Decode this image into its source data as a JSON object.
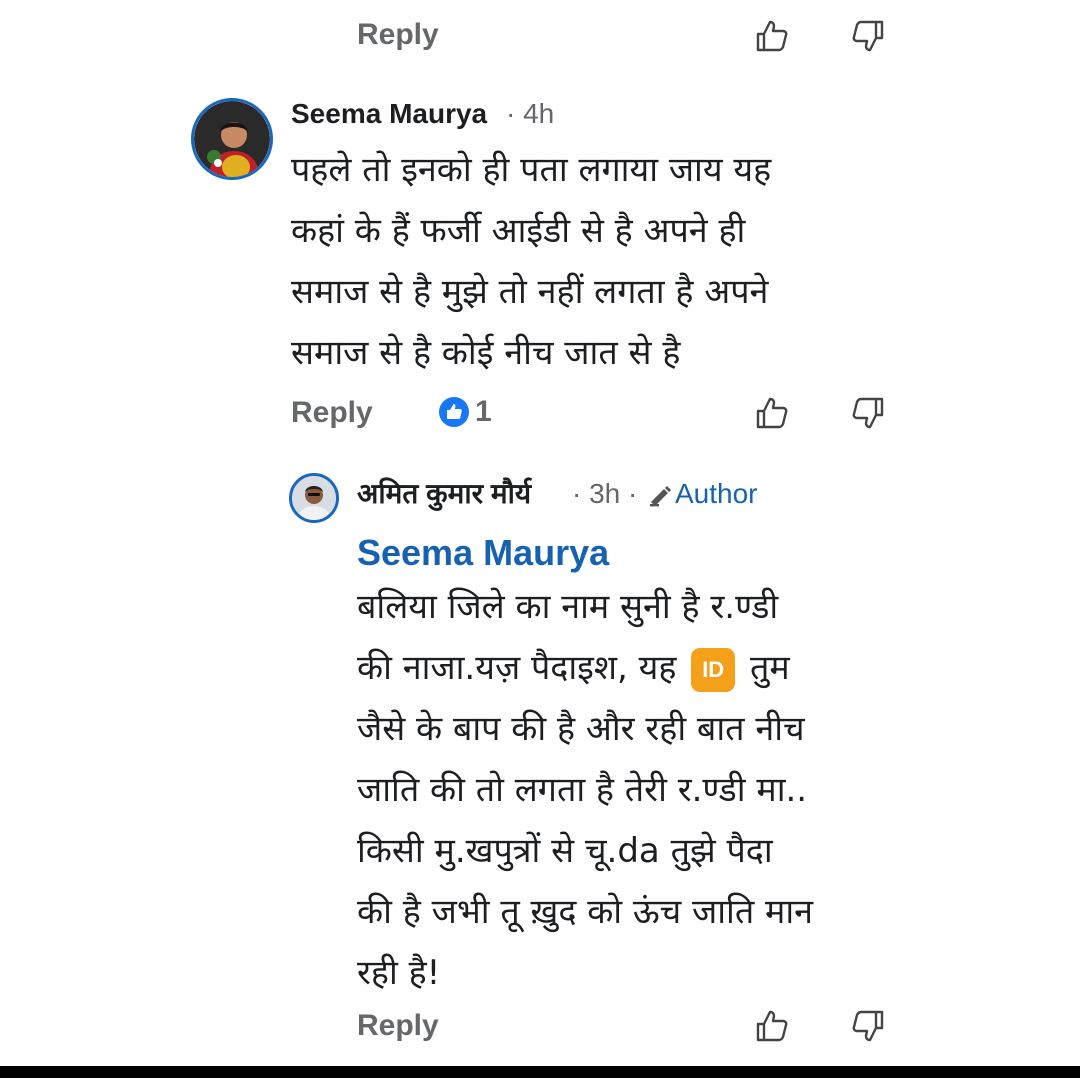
{
  "top_actions": {
    "reply_label": "Reply",
    "like_icon": "thumbs-up-icon",
    "dislike_icon": "thumbs-down-icon"
  },
  "comment": {
    "author": "Seema Maurya",
    "time": "· 4h",
    "lines": [
      "पहले तो इनको ही पता लगाया जाय यह",
      "कहां के हैं फर्जी आईडी से है अपने ही",
      "समाज से है मुझे तो नहीं लगता है अपने",
      "समाज से है कोई नीच जात से है"
    ],
    "reply_label": "Reply",
    "like_count": "1"
  },
  "reply": {
    "author": "अमित कुमार मौर्य",
    "time": "· 3h ·",
    "author_badge": "Author",
    "mention": "Seema Maurya",
    "line1": "बलिया जिले का नाम सुनी है र.ण्डी",
    "line2_before": "की नाजा.यज़ पैदाइश, यह",
    "line2_emoji": "ID",
    "line2_after": "तुम",
    "lines_rest": [
      "जैसे के बाप की है और रही बात नीच",
      "जाति की तो लगता है तेरी र.ण्डी मा..",
      "किसी मु.खपुत्रों से चू.da तुझे पैदा",
      "की है जभी तू ख़ुद को ऊंच जाति मान",
      "रही है!"
    ],
    "reply_label": "Reply"
  },
  "colors": {
    "accent": "#1762b0",
    "like_blue": "#1877f2",
    "muted": "#65676b",
    "avatar_ring": "#1a67c0"
  }
}
